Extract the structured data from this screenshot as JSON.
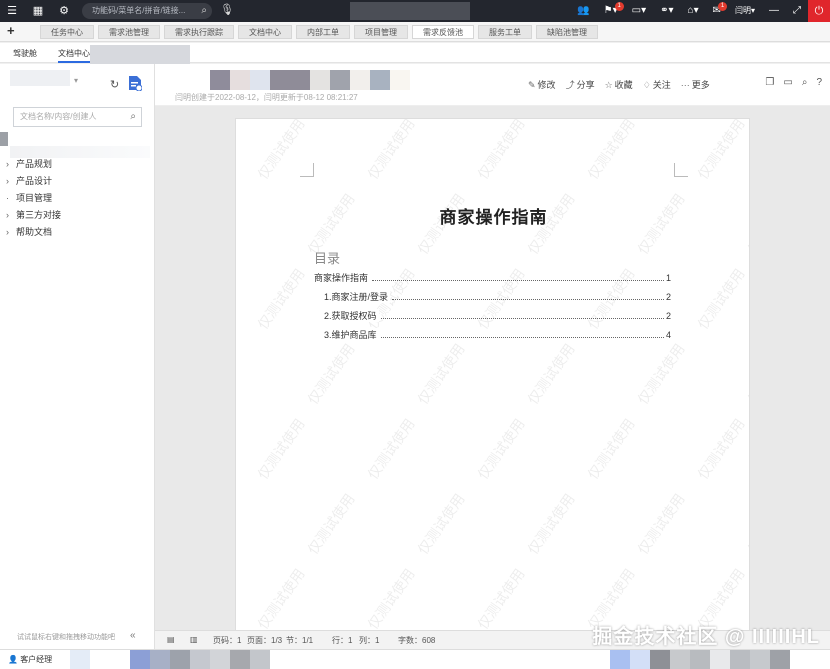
{
  "topbar": {
    "search_placeholder": "功能码/菜单名/拼音/链接...",
    "notification_badge_1": "1",
    "notification_badge_2": "1",
    "user_name": "闫明"
  },
  "main_tabs": [
    "任务中心",
    "需求池管理",
    "需求执行跟踪",
    "文档中心",
    "内部工单",
    "项目管理",
    "需求反馈池",
    "服务工单",
    "缺陷池管理"
  ],
  "sub_tabs": [
    "驾驶舱",
    "文档中心"
  ],
  "sidebar": {
    "search_placeholder": "文档名称/内容/创建人",
    "tree": [
      {
        "label": "产品规划",
        "expand": "›"
      },
      {
        "label": "产品设计",
        "expand": "›"
      },
      {
        "label": "项目管理",
        "expand": "·"
      },
      {
        "label": "第三方对接",
        "expand": "›"
      },
      {
        "label": "帮助文档",
        "expand": "›"
      }
    ],
    "hint": "试试鼠标右键和拖拽移动功能吧"
  },
  "doc_header": {
    "meta": "闫明创建于2022-08-12，闫明更新于08-12 08:21:27",
    "actions": [
      {
        "icon": "✎",
        "label": "修改"
      },
      {
        "icon": "⤴",
        "label": "分享"
      },
      {
        "icon": "☆",
        "label": "收藏"
      },
      {
        "icon": "♢",
        "label": "关注"
      },
      {
        "icon": "···",
        "label": "更多"
      }
    ]
  },
  "document": {
    "title": "商家操作指南",
    "toc_title": "目录",
    "watermark": "仅测试使用",
    "toc": [
      {
        "label": "商家操作指南",
        "page": "1",
        "level": 0
      },
      {
        "label": "1.商家注册/登录",
        "page": "2",
        "level": 1
      },
      {
        "label": "2.获取授权码",
        "page": "2",
        "level": 1
      },
      {
        "label": "3.维护商品库",
        "page": "4",
        "level": 1
      }
    ]
  },
  "statusbar": {
    "page_no": "页码：1",
    "page_count": "页面：1/3",
    "section": "节：1/1",
    "row": "行：1",
    "col": "列：1",
    "word_count": "字数：608"
  },
  "bottombar": {
    "item": "客户经理"
  },
  "site_watermark": "掘金技术社区 @ IIIIIIHL"
}
